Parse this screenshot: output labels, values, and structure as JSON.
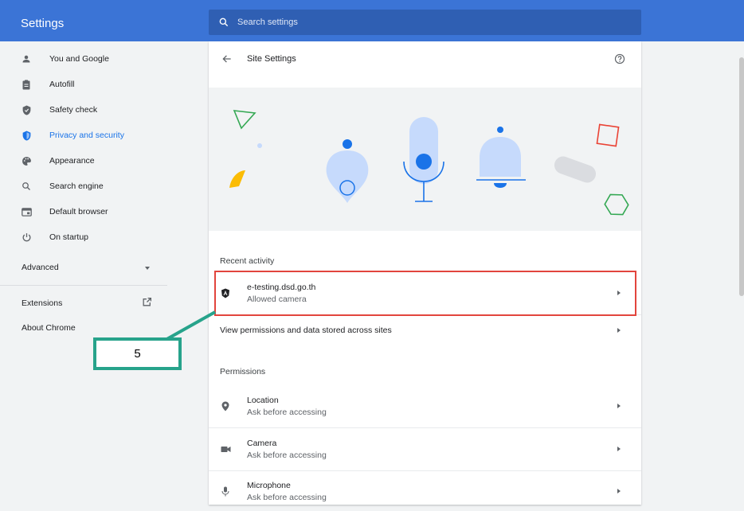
{
  "app": {
    "title": "Settings"
  },
  "search": {
    "placeholder": "Search settings"
  },
  "sidebar": {
    "items": [
      {
        "label": "You and Google",
        "icon": "person-icon"
      },
      {
        "label": "Autofill",
        "icon": "clipboard-icon"
      },
      {
        "label": "Safety check",
        "icon": "shield-check-icon"
      },
      {
        "label": "Privacy and security",
        "icon": "shield-icon",
        "active": true
      },
      {
        "label": "Appearance",
        "icon": "palette-icon"
      },
      {
        "label": "Search engine",
        "icon": "search-icon"
      },
      {
        "label": "Default browser",
        "icon": "browser-icon"
      },
      {
        "label": "On startup",
        "icon": "power-icon"
      }
    ],
    "advanced": "Advanced",
    "extensions": "Extensions",
    "about": "About Chrome"
  },
  "main": {
    "title": "Site Settings",
    "recent_activity": {
      "heading": "Recent activity",
      "items": [
        {
          "site": "e-testing.dsd.go.th",
          "detail": "Allowed camera"
        }
      ]
    },
    "view_permissions": "View permissions and data stored across sites",
    "permissions": {
      "heading": "Permissions",
      "items": [
        {
          "label": "Location",
          "detail": "Ask before accessing",
          "icon": "location-pin-icon"
        },
        {
          "label": "Camera",
          "detail": "Ask before accessing",
          "icon": "camera-icon"
        },
        {
          "label": "Microphone",
          "detail": "Ask before accessing",
          "icon": "microphone-icon"
        }
      ]
    }
  },
  "annotation": {
    "label": "5",
    "color": "#27a38b",
    "highlight_color": "#e2453d"
  },
  "colors": {
    "accent": "#1a73e8",
    "topbar": "#3b74d6"
  }
}
